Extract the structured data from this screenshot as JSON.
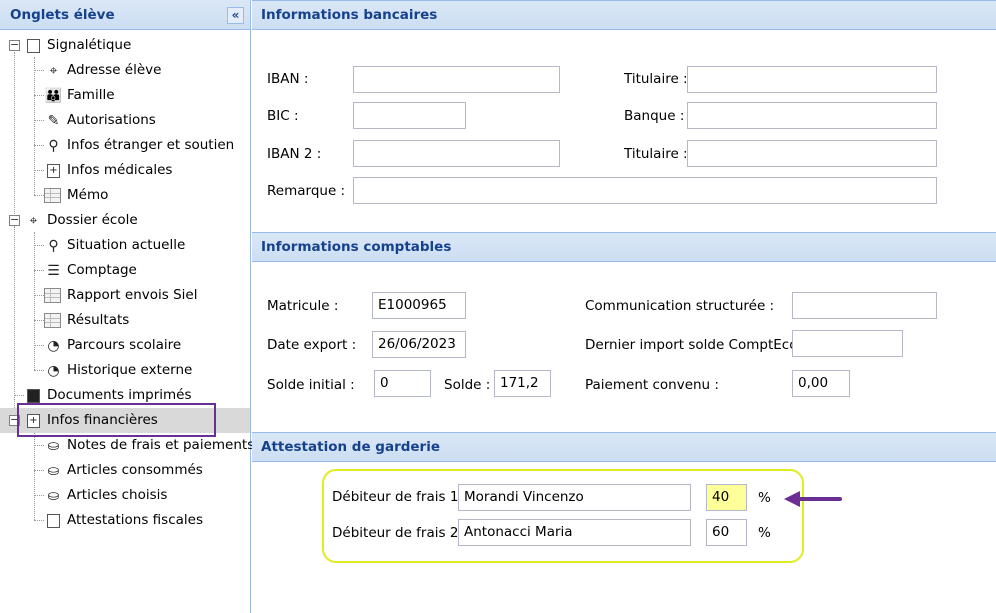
{
  "left_panel": {
    "title": "Onglets élève",
    "collapse_glyph": "«",
    "tree": [
      {
        "label": "Signalétique",
        "icon": "edit-document-icon"
      },
      {
        "label": "Adresse élève",
        "icon": "map-pin-icon"
      },
      {
        "label": "Famille",
        "icon": "family-icon"
      },
      {
        "label": "Autorisations",
        "icon": "pencil-icon"
      },
      {
        "label": "Infos étranger et soutien",
        "icon": "pin-icon"
      },
      {
        "label": "Infos médicales",
        "icon": "medical-icon"
      },
      {
        "label": "Mémo",
        "icon": "grid-icon"
      },
      {
        "label": "Dossier école",
        "icon": "map-pin-icon"
      },
      {
        "label": "Situation actuelle",
        "icon": "search-icon"
      },
      {
        "label": "Comptage",
        "icon": "list-icon"
      },
      {
        "label": "Rapport envois Siel",
        "icon": "grid-icon"
      },
      {
        "label": "Résultats",
        "icon": "grid-icon"
      },
      {
        "label": "Parcours scolaire",
        "icon": "clock-icon"
      },
      {
        "label": "Historique externe",
        "icon": "clock-icon"
      },
      {
        "label": "Documents imprimés",
        "icon": "printed-document-icon"
      },
      {
        "label": "Infos financières",
        "icon": "finance-icon"
      },
      {
        "label": "Notes de frais et paiements",
        "icon": "piggy-bank-icon"
      },
      {
        "label": "Articles consommés",
        "icon": "piggy-bank-icon"
      },
      {
        "label": "Articles choisis",
        "icon": "piggy-bank-icon"
      },
      {
        "label": "Attestations fiscales",
        "icon": "edit-document-icon"
      }
    ],
    "toggle_glyph": "−"
  },
  "bank": {
    "title": "Informations bancaires",
    "iban_label": "IBAN :",
    "iban_value": "",
    "titulaire1_label": "Titulaire :",
    "titulaire1_value": "",
    "bic_label": "BIC :",
    "bic_value": "",
    "banque_label": "Banque :",
    "banque_value": "",
    "iban2_label": "IBAN 2 :",
    "iban2_value": "",
    "titulaire2_label": "Titulaire :",
    "titulaire2_value": "",
    "remarque_label": "Remarque :",
    "remarque_value": ""
  },
  "accounting": {
    "title": "Informations comptables",
    "matricule_label": "Matricule :",
    "matricule_value": "E1000965",
    "comm_label": "Communication structurée :",
    "comm_value": "",
    "date_export_label": "Date export :",
    "date_export_value": "26/06/2023",
    "dernier_import_label": "Dernier import solde ComptEco :",
    "dernier_import_value": "",
    "solde_initial_label": "Solde initial :",
    "solde_initial_value": "0",
    "solde_label": "Solde :",
    "solde_value": "171,2",
    "paiement_label": "Paiement convenu :",
    "paiement_value": "0,00"
  },
  "garderie": {
    "title": "Attestation de garderie",
    "debiteur1_label": "Débiteur de frais 1 :",
    "debiteur1_value": "Morandi Vincenzo",
    "debiteur1_pct": "40",
    "debiteur2_label": "Débiteur de frais 2 :",
    "debiteur2_value": "Antonacci Maria",
    "debiteur2_pct": "60",
    "pct_symbol": "%"
  },
  "colors": {
    "header_text": "#15428b",
    "selection_outline": "#6b2f93",
    "highlight_outline": "#e1eb1f",
    "highlight_field": "#ffff99",
    "arrow": "#6b2f93"
  }
}
